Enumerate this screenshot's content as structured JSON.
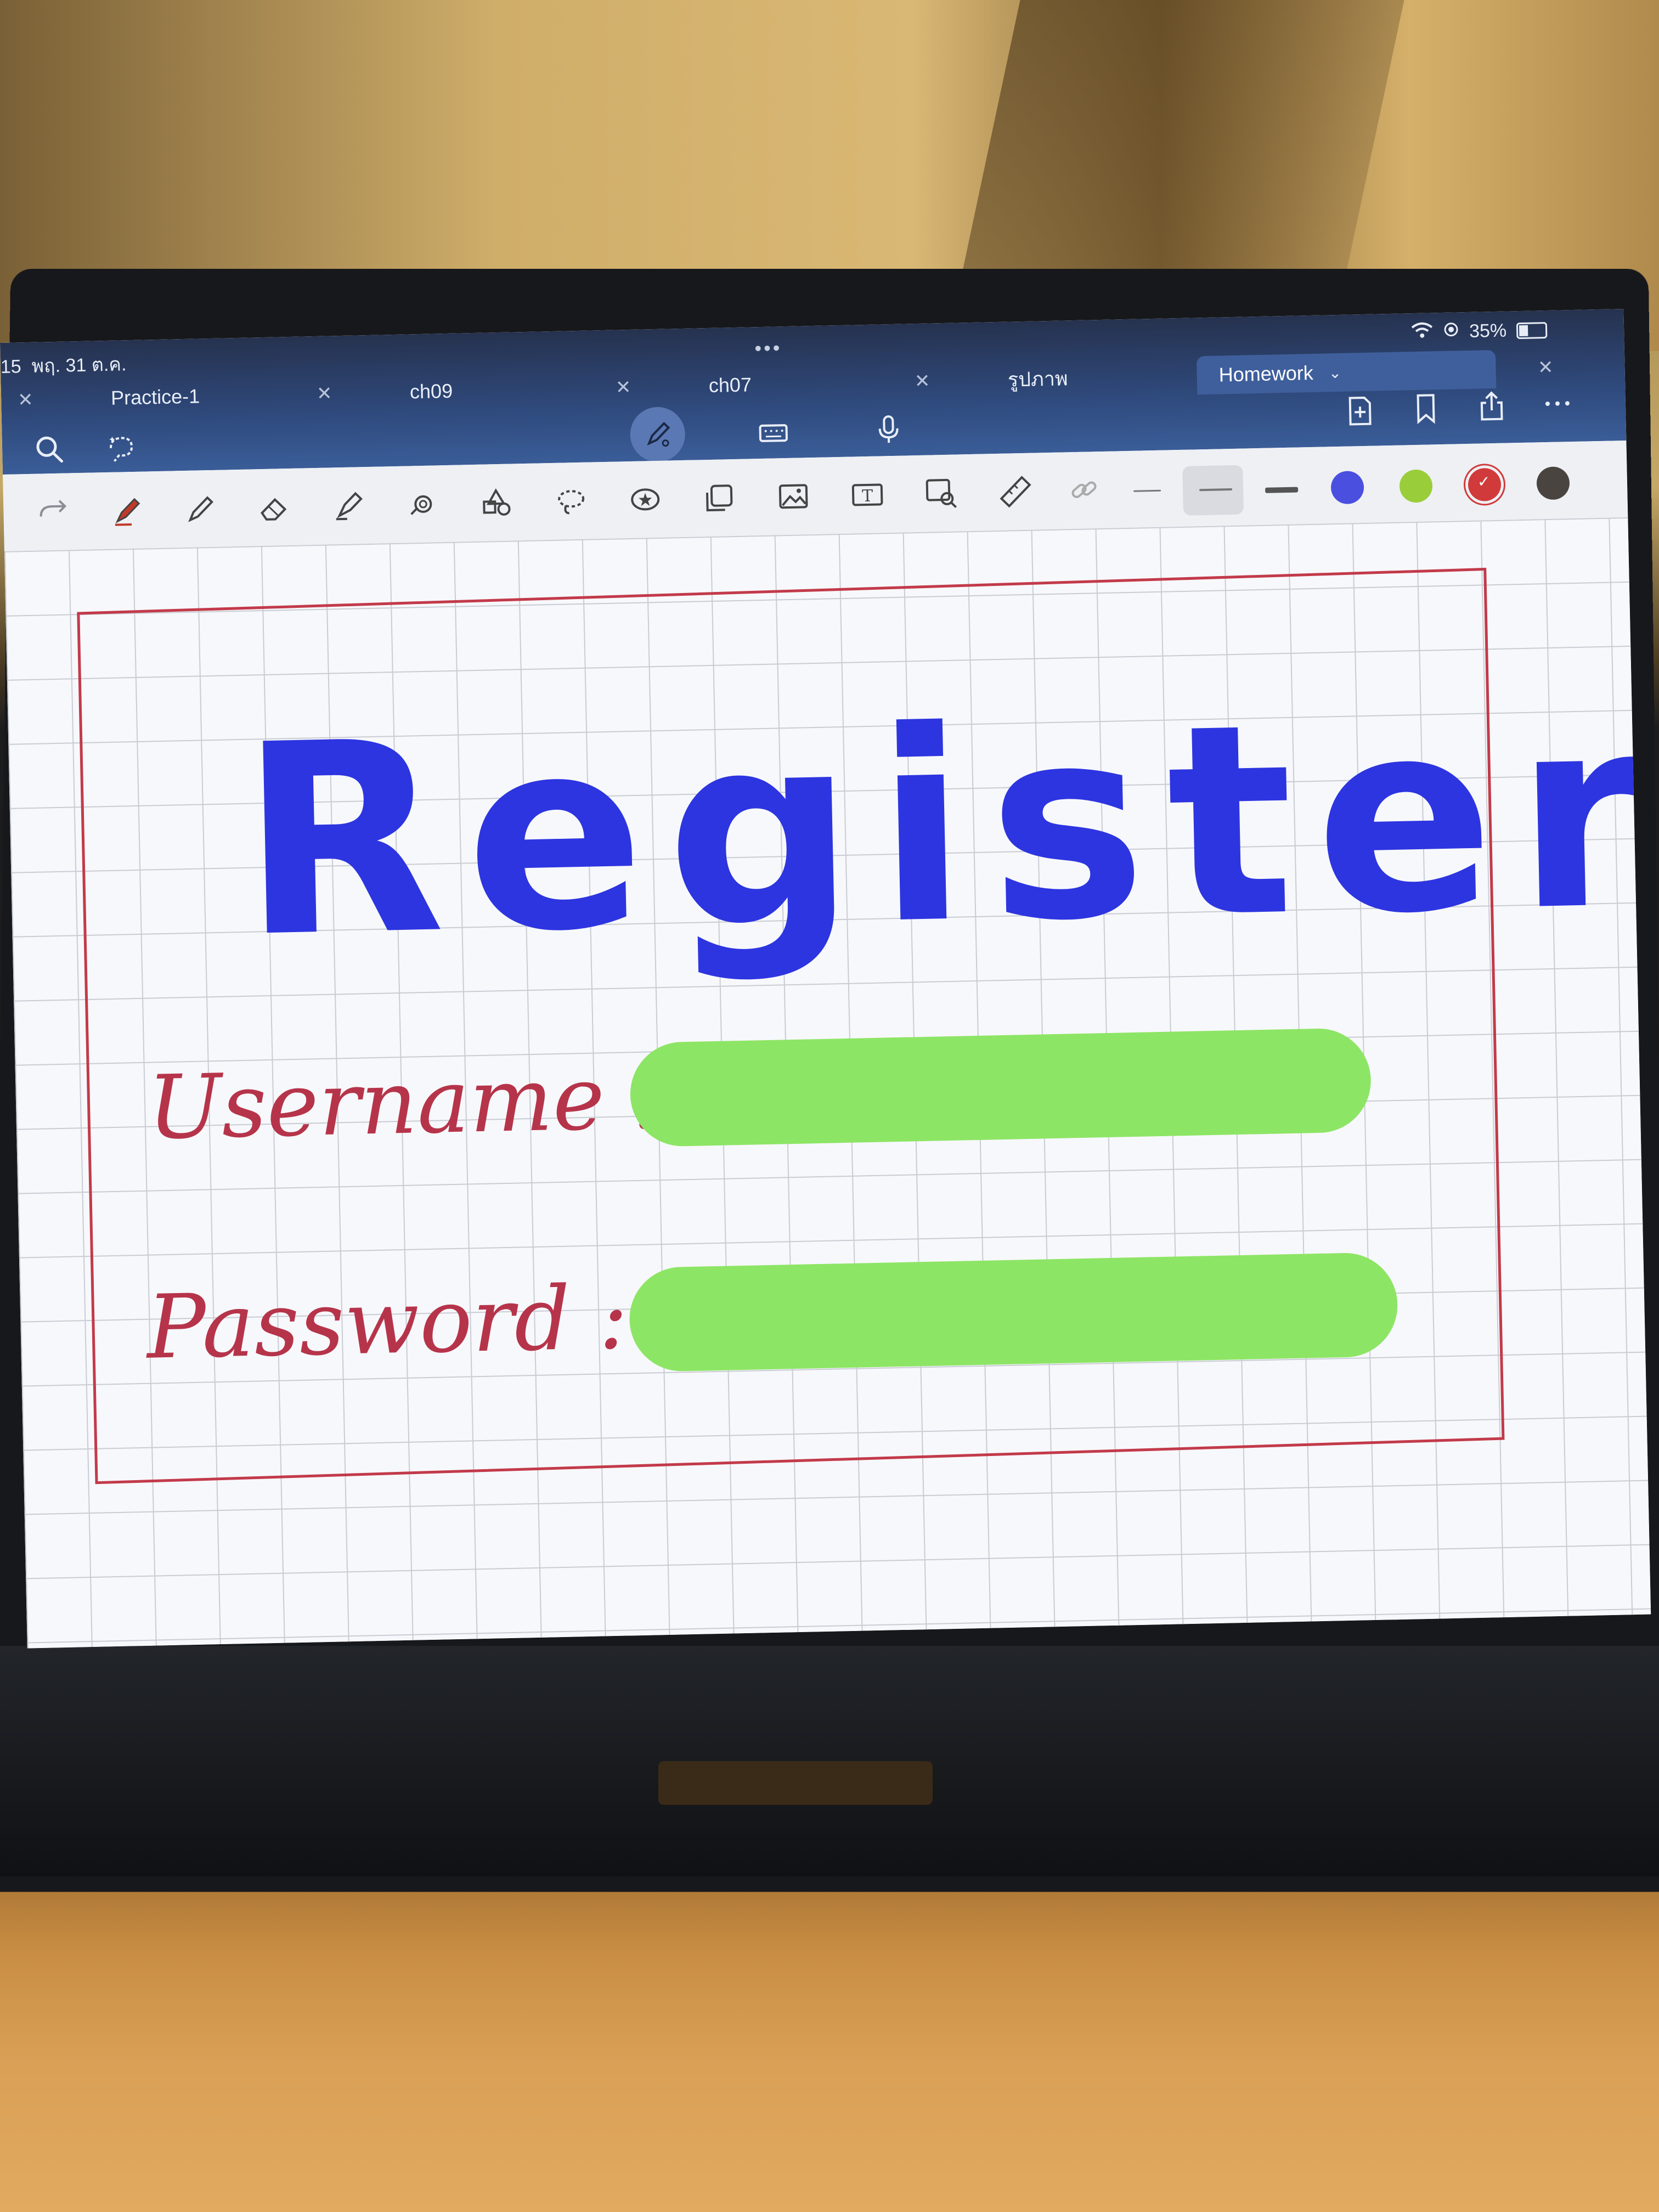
{
  "status_bar": {
    "time": "15",
    "date": "พฤ. 31 ต.ค.",
    "battery": "35%"
  },
  "tabs": [
    {
      "label": "Practice-1",
      "active": false
    },
    {
      "label": "ch09",
      "active": false
    },
    {
      "label": "ch07",
      "active": false
    },
    {
      "label": "รูปภาพ",
      "active": false
    },
    {
      "label": "Homework",
      "active": true
    }
  ],
  "top_icons": [
    "search-icon",
    "lasso-ai-icon",
    "pen-mode-icon",
    "keyboard-icon",
    "microphone-icon",
    "add-page-icon",
    "bookmark-icon",
    "share-icon",
    "more-icon"
  ],
  "toolbar": {
    "tools": [
      "redo-icon",
      "pen-icon",
      "pencil-icon",
      "eraser-icon",
      "highlighter-icon",
      "shape-icon",
      "sticker-tool-icon",
      "lasso-icon",
      "star-icon",
      "copy-icon",
      "image-icon",
      "text-icon",
      "image-search-icon",
      "ruler-icon",
      "link-icon"
    ],
    "colors": [
      "#4a4fe0",
      "#9acd3a",
      "#d13a3a",
      "#4a4440"
    ]
  },
  "canvas": {
    "title": "Registers",
    "username_label": "Username :",
    "password_label": "Password :",
    "title_color": "#2d35e0",
    "label_color": "#b6344a",
    "field_color": "#8de565",
    "frame_color": "#c23a4a"
  }
}
